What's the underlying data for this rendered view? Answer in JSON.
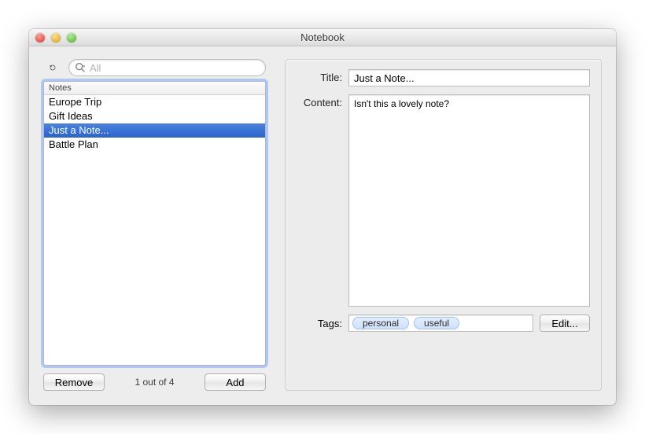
{
  "window": {
    "title": "Notebook"
  },
  "sidebar": {
    "search_placeholder": "All",
    "list_header": "Notes",
    "items": [
      {
        "label": "Europe Trip",
        "selected": false
      },
      {
        "label": "Gift Ideas",
        "selected": false
      },
      {
        "label": "Just a Note...",
        "selected": true
      },
      {
        "label": "Battle Plan",
        "selected": false
      }
    ],
    "remove_label": "Remove",
    "add_label": "Add",
    "counter": "1 out of 4"
  },
  "detail": {
    "title_label": "Title:",
    "title_value": "Just a Note...",
    "content_label": "Content:",
    "content_value": "Isn't this a lovely note?",
    "tags_label": "Tags:",
    "tags": [
      "personal",
      "useful"
    ],
    "edit_label": "Edit..."
  }
}
